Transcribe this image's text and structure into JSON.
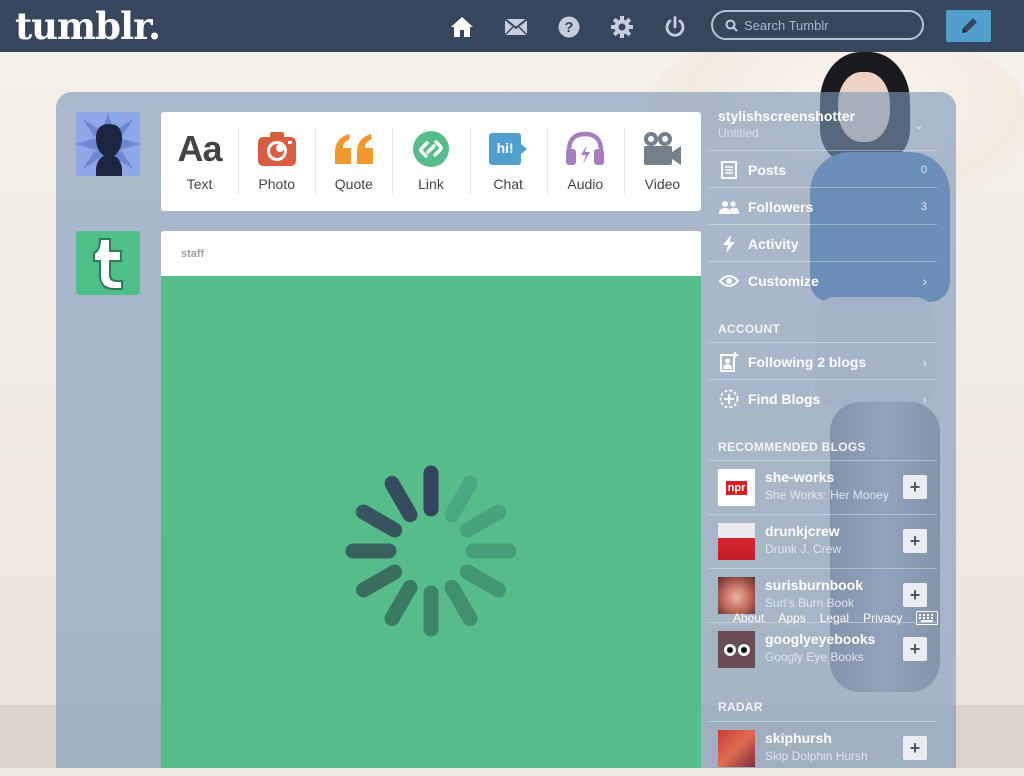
{
  "header": {
    "logo": "tumblr.",
    "search_placeholder": "Search Tumblr",
    "nav_icons": [
      "home-icon",
      "mail-icon",
      "help-icon",
      "settings-icon",
      "power-icon"
    ]
  },
  "post_types": [
    {
      "label": "Text",
      "color": "#444444"
    },
    {
      "label": "Photo",
      "color": "#d95e40"
    },
    {
      "label": "Quote",
      "color": "#f2992e"
    },
    {
      "label": "Link",
      "color": "#56bc8a"
    },
    {
      "label": "Chat",
      "color": "#529ecc"
    },
    {
      "label": "Audio",
      "color": "#a77dc2"
    },
    {
      "label": "Video",
      "color": "#748089"
    }
  ],
  "post_types_text_glyph": "Aa",
  "chat_glyph": "hi!",
  "post": {
    "author": "staff",
    "loading": true,
    "background": "#56bc8a"
  },
  "sidebar": {
    "blog_name": "stylishscreenshotter",
    "blog_subtitle": "Untitled",
    "items": [
      {
        "label": "Posts",
        "count": "0"
      },
      {
        "label": "Followers",
        "count": "3"
      },
      {
        "label": "Activity",
        "count": ""
      },
      {
        "label": "Customize",
        "count": ""
      }
    ],
    "account_heading": "ACCOUNT",
    "account_items": [
      {
        "label": "Following 2 blogs"
      },
      {
        "label": "Find Blogs"
      }
    ],
    "recommended_heading": "RECOMMENDED BLOGS",
    "recommended": [
      {
        "name": "she-works",
        "subtitle": "She Works: Her Money"
      },
      {
        "name": "drunkjcrew",
        "subtitle": "Drunk J. Crew"
      },
      {
        "name": "surisburnbook",
        "subtitle": "Suri's Burn Book"
      },
      {
        "name": "googlyeyebooks",
        "subtitle": "Googly Eye Books"
      }
    ],
    "radar_heading": "RADAR",
    "radar": [
      {
        "name": "skiphursh",
        "subtitle": "Skip Dolphin Hursh"
      }
    ],
    "footer_links": [
      "About",
      "Apps",
      "Legal",
      "Privacy"
    ],
    "npr_logo": "npr"
  },
  "colors": {
    "topbar": "#36465d",
    "accent": "#529ecc",
    "panel": "#7a98b8"
  }
}
